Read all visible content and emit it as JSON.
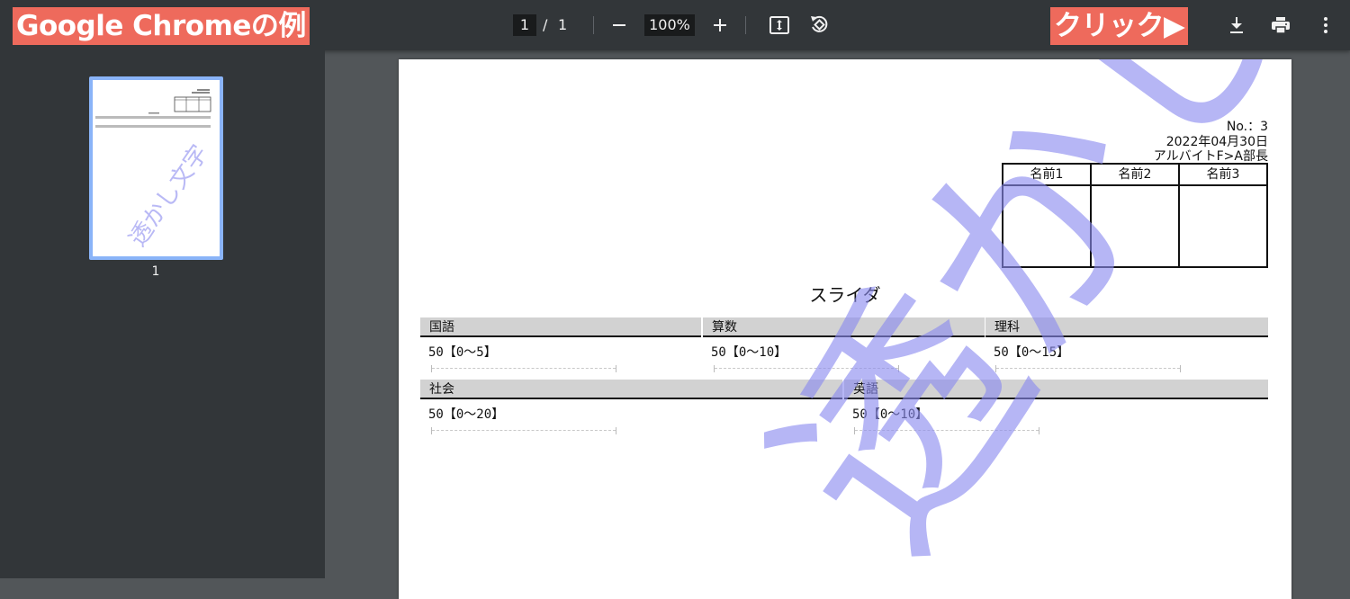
{
  "annotations": {
    "chrome_example": "Google Chromeの例",
    "click_hint": "クリック▶"
  },
  "toolbar": {
    "page_current": "1",
    "page_separator": "/",
    "page_total": "1",
    "zoom": "100%",
    "icons": [
      "zoom-out-icon",
      "zoom-in-icon",
      "fit-page-icon",
      "rotate-icon",
      "download-icon",
      "print-icon",
      "more-vert-icon"
    ]
  },
  "sidebar": {
    "thumbnail_page_number": "1"
  },
  "document": {
    "number": "No.：3",
    "date": "2022年04月30日",
    "department": "アルバイトF>A部長",
    "stamp_headers": [
      "名前1",
      "名前2",
      "名前3"
    ],
    "title": "スライダ",
    "rows": [
      {
        "fields": [
          {
            "label": "国語",
            "value": "50【0～5】"
          },
          {
            "label": "算数",
            "value": "50【0～10】"
          },
          {
            "label": "理科",
            "value": "50【0～15】"
          }
        ]
      },
      {
        "fields": [
          {
            "label": "社会",
            "value": "50【0～20】"
          },
          {
            "label": "英語",
            "value": "50【0～10】"
          }
        ]
      }
    ],
    "watermark_text": "透かし文字",
    "watermark_color": "#8b8bf0"
  },
  "colors": {
    "toolbar_bg": "#323639",
    "viewer_bg": "#525659",
    "annotation_orange": "#ee6a5c",
    "thumb_border": "#8ab4f8"
  }
}
